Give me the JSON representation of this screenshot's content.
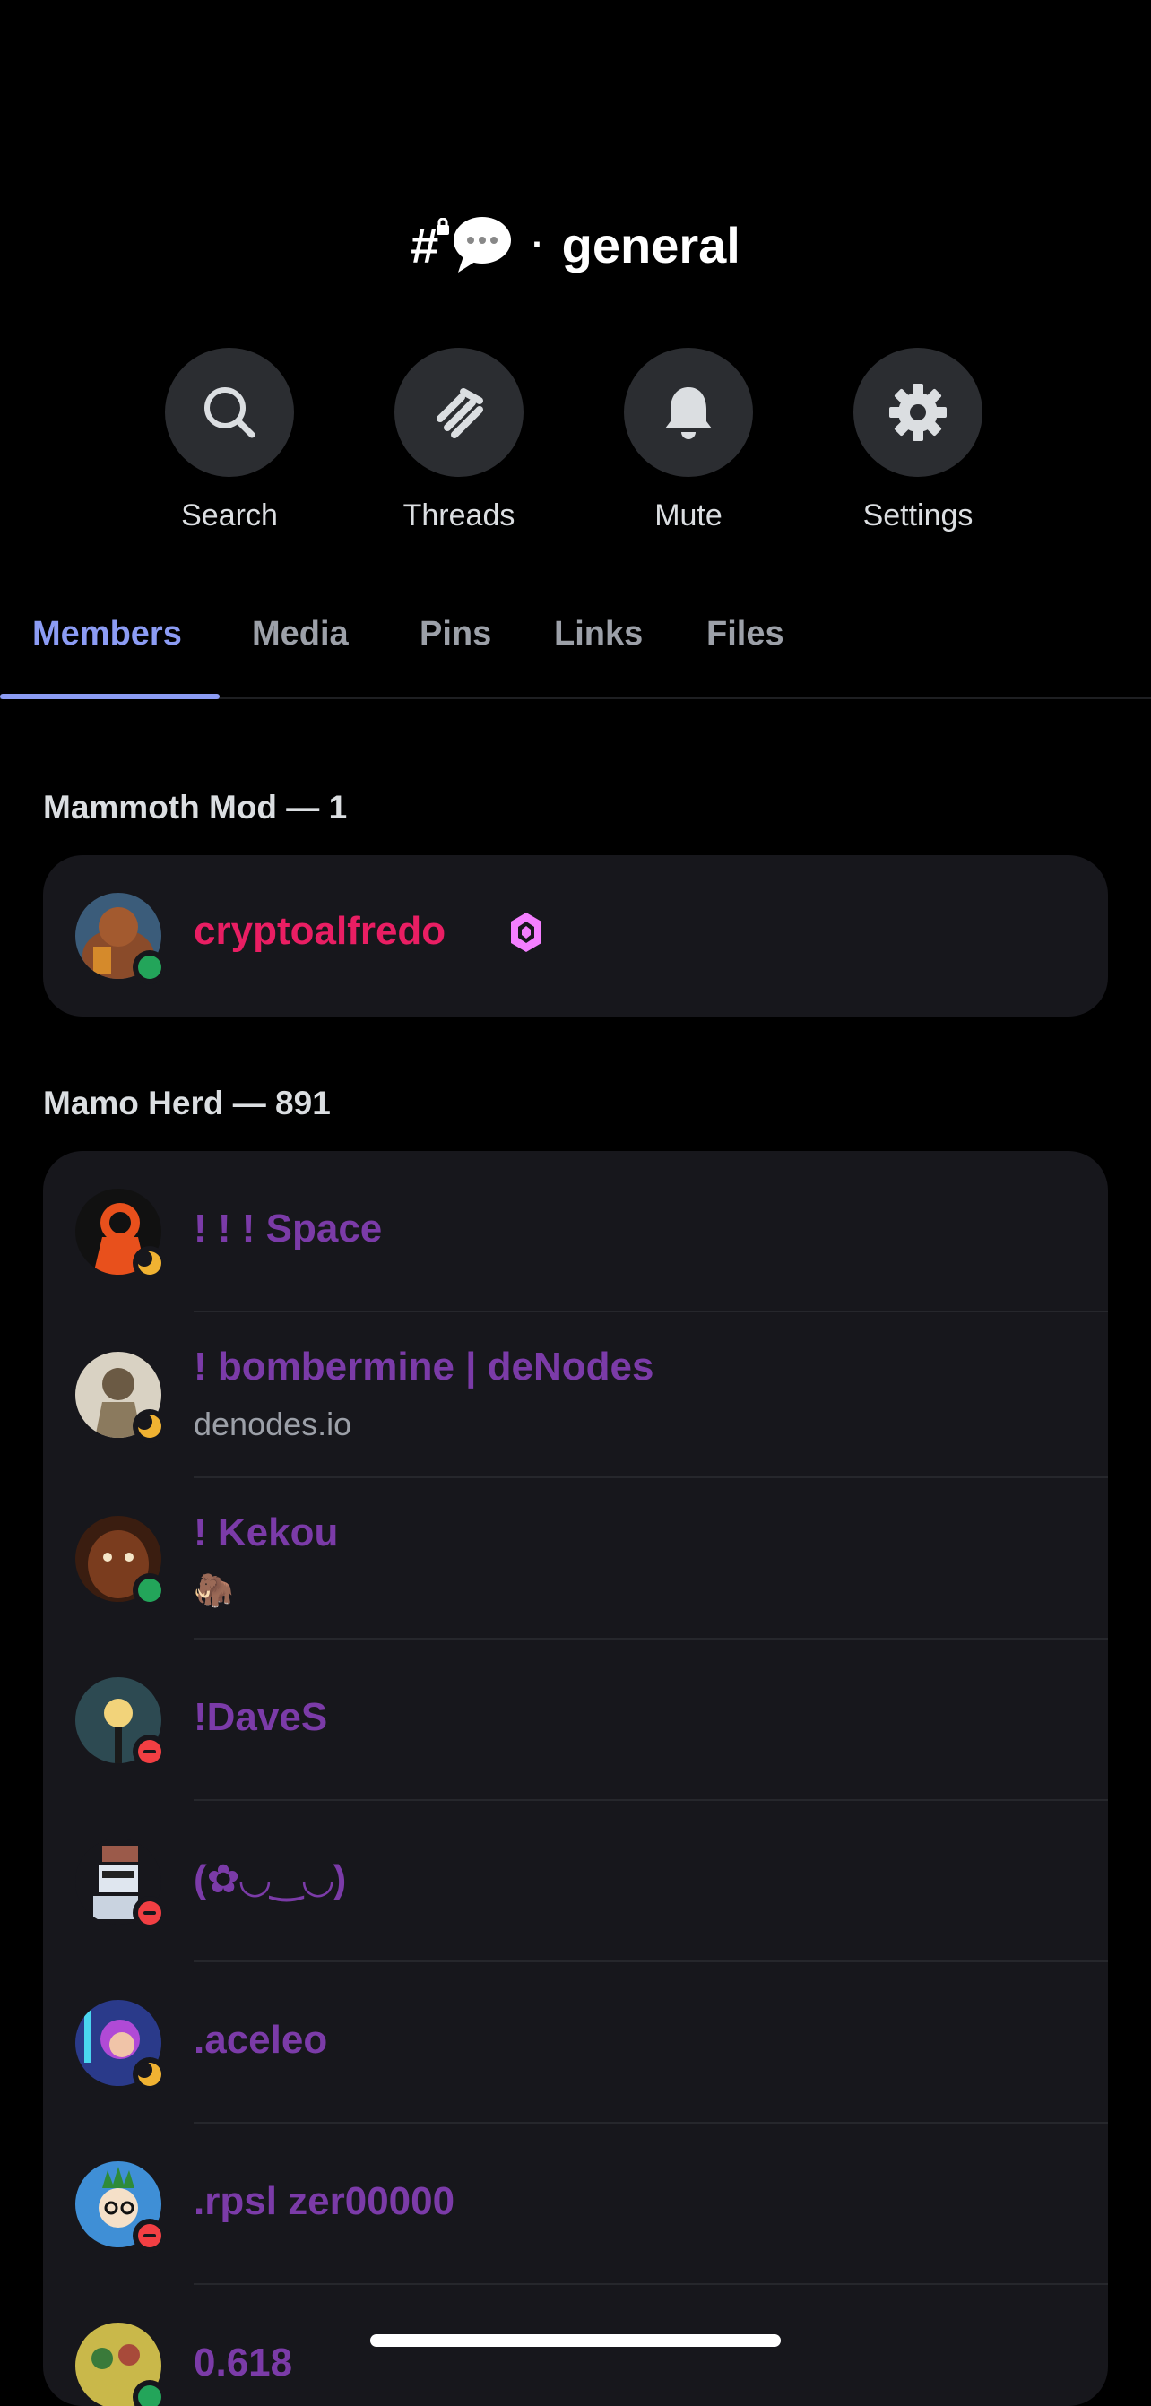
{
  "channel": {
    "name": "general",
    "separator": "·"
  },
  "actions": [
    {
      "label": "Search",
      "icon": "search-icon"
    },
    {
      "label": "Threads",
      "icon": "threads-icon"
    },
    {
      "label": "Mute",
      "icon": "bell-icon"
    },
    {
      "label": "Settings",
      "icon": "gear-icon"
    }
  ],
  "tabs": [
    "Members",
    "Media",
    "Pins",
    "Links",
    "Files"
  ],
  "active_tab": "Members",
  "colors": {
    "accent": "#8c9cf4",
    "mod_name": "#e91e63",
    "herd_name": "#7b3ba8",
    "online": "#23a55a",
    "idle": "#f0b232",
    "dnd": "#f23f43"
  },
  "sections": [
    {
      "title": "Mammoth Mod — 1",
      "members": [
        {
          "name": "cryptoalfredo",
          "status": "online",
          "badge": "nitro-gem-icon"
        }
      ]
    },
    {
      "title": "Mamo Herd — 891",
      "members": [
        {
          "name": "! ! ! Space",
          "status": "idle"
        },
        {
          "name": "! bombermine | deNodes",
          "sub": "denodes.io",
          "status": "idle"
        },
        {
          "name": "! Kekou",
          "sub": "🦣",
          "status": "online"
        },
        {
          "name": "!DaveS",
          "status": "dnd"
        },
        {
          "name": "(✿◡‿◡)",
          "status": "dnd"
        },
        {
          "name": ".aceleo",
          "status": "idle"
        },
        {
          "name": ".rpsl zer00000",
          "status": "dnd"
        },
        {
          "name": "0.618",
          "status": "online"
        }
      ]
    }
  ]
}
